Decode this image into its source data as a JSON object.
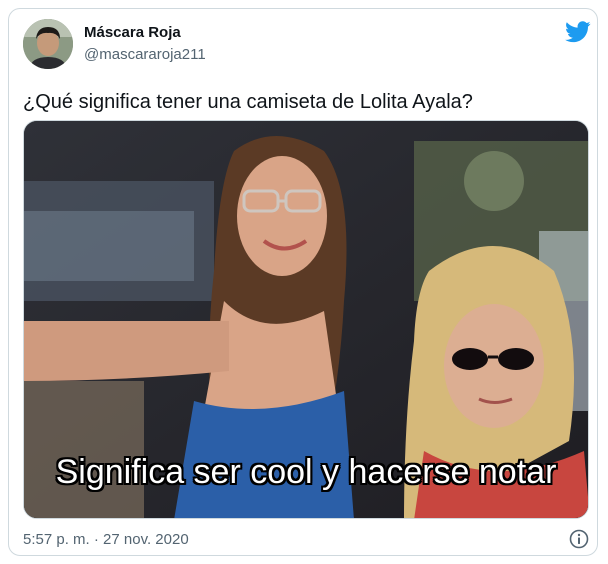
{
  "tweet": {
    "author": {
      "display_name": "Máscara Roja",
      "handle": "@mascararoja211",
      "avatar_icon": "user-avatar"
    },
    "brand_icon": "twitter-bird-icon",
    "brand_color": "#1d9bf0",
    "text": "¿Qué significa tener una camiseta de Lolita Ayala?",
    "media": {
      "caption": "Significa ser cool y hacerse notar"
    },
    "time": "5:57 p. m.",
    "separator": "·",
    "date": "27 nov. 2020",
    "info_icon": "info-icon"
  }
}
